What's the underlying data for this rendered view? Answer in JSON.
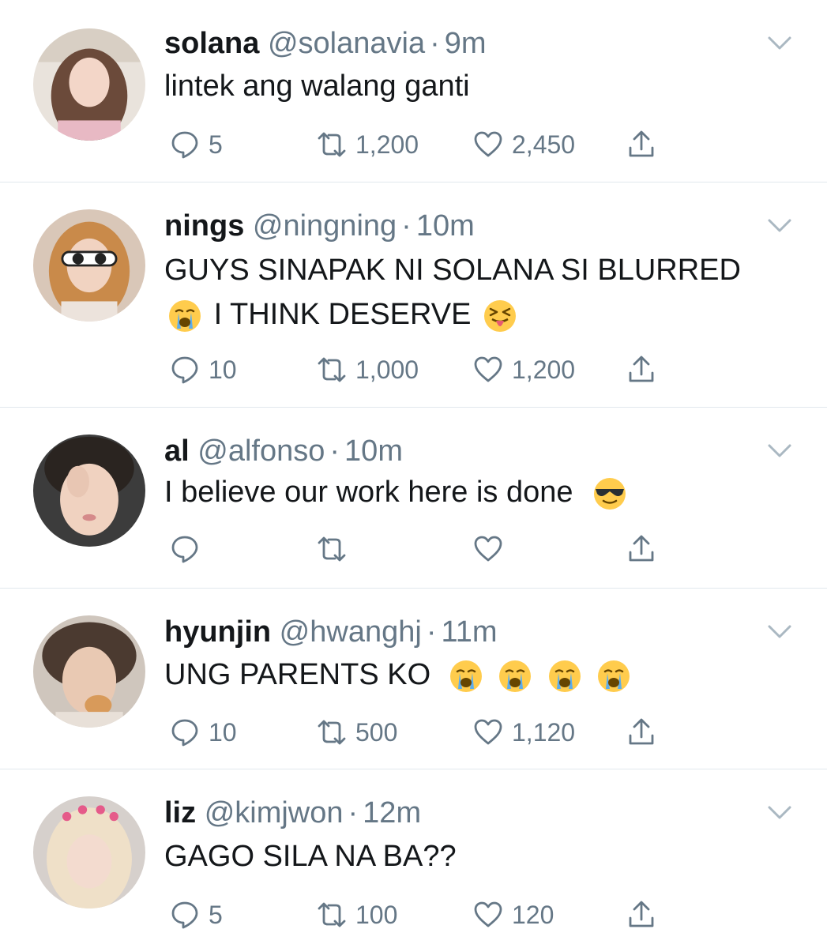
{
  "tweets": [
    {
      "name": "solana",
      "handle": "@solanavia",
      "time": "9m",
      "text_line1": "lintek ang walang ganti",
      "text_line2": "",
      "replies": "5",
      "retweets": "1,200",
      "likes": "2,450"
    },
    {
      "name": "nings",
      "handle": "@ningning",
      "time": "10m",
      "text_line1": "GUYS SINAPAK NI SOLANA SI BLURRED",
      "text_line2": "I THINK DESERVE",
      "replies": "10",
      "retweets": "1,000",
      "likes": "1,200"
    },
    {
      "name": "al",
      "handle": "@alfonso",
      "time": "10m",
      "text_line1": "I believe our work here is done",
      "text_line2": "",
      "replies": "",
      "retweets": "",
      "likes": ""
    },
    {
      "name": "hyunjin",
      "handle": "@hwanghj",
      "time": "11m",
      "text_line1": "UNG PARENTS KO",
      "text_line2": "",
      "replies": "10",
      "retweets": "500",
      "likes": "1,120"
    },
    {
      "name": "liz",
      "handle": "@kimjwon",
      "time": "12m",
      "text_line1": "GAGO SILA NA BA??",
      "text_line2": "",
      "replies": "5",
      "retweets": "100",
      "likes": "120"
    }
  ],
  "separator": "·",
  "colors": {
    "text": "#14171a",
    "muted": "#657786",
    "divider": "#e1e8ed"
  },
  "icons": [
    "reply-icon",
    "retweet-icon",
    "like-icon",
    "share-icon",
    "chevron-down-icon",
    "crying-emoji",
    "squinting-tongue-emoji",
    "sunglasses-emoji"
  ]
}
